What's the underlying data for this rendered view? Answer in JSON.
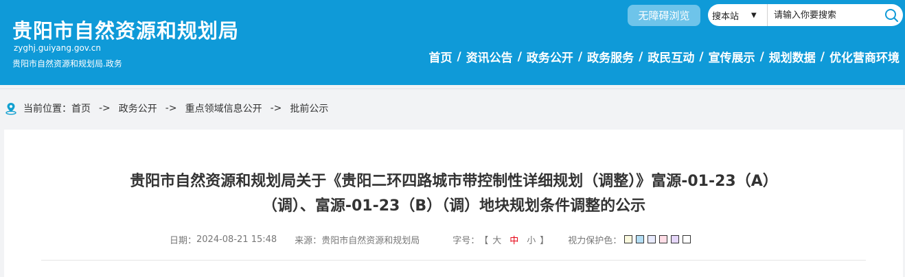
{
  "header": {
    "site_title": "贵阳市自然资源和规划局",
    "domain": "zyghj.guiyang.gov.cn",
    "subtitle": "贵阳市自然资源和规划局.政务",
    "accessibility_label": "无障碍浏览",
    "bg_color": "#0f9ad8"
  },
  "search": {
    "scope_label": "搜本站",
    "placeholder": "请输入你要搜索"
  },
  "nav": {
    "items": [
      "首页",
      "资讯公告",
      "政务公开",
      "政务服务",
      "政民互动",
      "宣传展示",
      "规划数据",
      "优化营商环境"
    ],
    "separator": "/"
  },
  "breadcrumb": {
    "prefix": "当前位置：",
    "separator": "->",
    "items": [
      "首页",
      "政务公开",
      "重点领域信息公开",
      "批前公示"
    ]
  },
  "article": {
    "title_line1": "贵阳市自然资源和规划局关于《贵阳二环四路城市带控制性详细规划（调整）》富源-01-23（A）",
    "title_line2": "（调）、富源-01-23（B）（调）地块规划条件调整的公示",
    "date_label": "日期：",
    "date_value": "2024-08-21 15:48",
    "source_label": "来源：",
    "source_value": "贵阳市自然资源和规划局",
    "font_size_label": "字号：",
    "font_size_open": "【",
    "font_size_large": "大",
    "font_size_medium": "中",
    "font_size_small": "小",
    "font_size_close": "】",
    "eye_care_label": "视力保护色：",
    "eye_care_colors": [
      "#faf9de",
      "#b4def5",
      "#e9ebfe",
      "#ffdde6",
      "#e5d6fa",
      "#ffffff"
    ]
  }
}
